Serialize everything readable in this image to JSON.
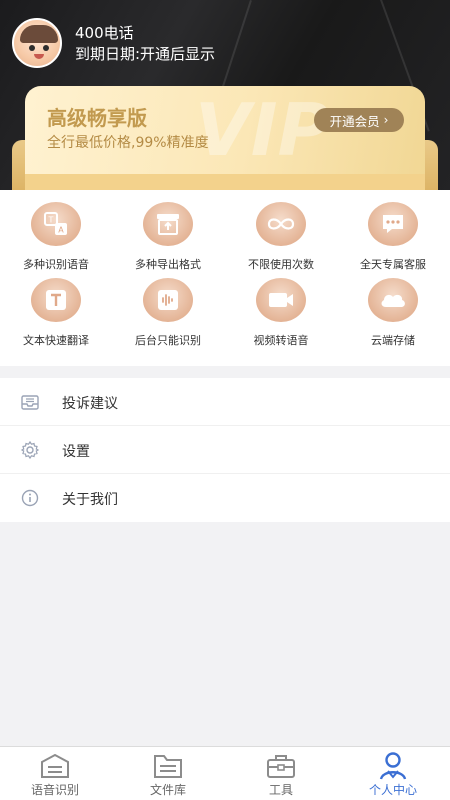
{
  "header": {
    "user_title": "400电话",
    "expiry": "到期日期:开通后显示"
  },
  "vip": {
    "title": "高级畅享版",
    "subtitle": "全行最低价格,99%精准度",
    "button": "开通会员",
    "watermark": "VIP"
  },
  "features": [
    {
      "label": "多种识别语音",
      "icon": "translate-icon"
    },
    {
      "label": "多种导出格式",
      "icon": "export-icon"
    },
    {
      "label": "不限使用次数",
      "icon": "infinity-icon"
    },
    {
      "label": "全天专属客服",
      "icon": "chat-icon"
    },
    {
      "label": "文本快速翻译",
      "icon": "text-translate-icon"
    },
    {
      "label": "后台只能识别",
      "icon": "audio-wave-icon"
    },
    {
      "label": "视频转语音",
      "icon": "video-camera-icon"
    },
    {
      "label": "云端存储",
      "icon": "cloud-icon"
    }
  ],
  "menu": [
    {
      "label": "投诉建议",
      "icon": "mailbox-icon"
    },
    {
      "label": "设置",
      "icon": "gear-icon"
    },
    {
      "label": "关于我们",
      "icon": "info-icon"
    }
  ],
  "tabbar": [
    {
      "label": "语音识别",
      "icon": "speech-box-icon",
      "active": false
    },
    {
      "label": "文件库",
      "icon": "folder-icon",
      "active": false
    },
    {
      "label": "工具",
      "icon": "toolbox-icon",
      "active": false
    },
    {
      "label": "个人中心",
      "icon": "person-icon",
      "active": true
    }
  ],
  "colors": {
    "accent": "#3b6fd3",
    "gold_text": "#c29a4f",
    "vip_button": "#a08357",
    "header_bg": "#1e1e20"
  }
}
